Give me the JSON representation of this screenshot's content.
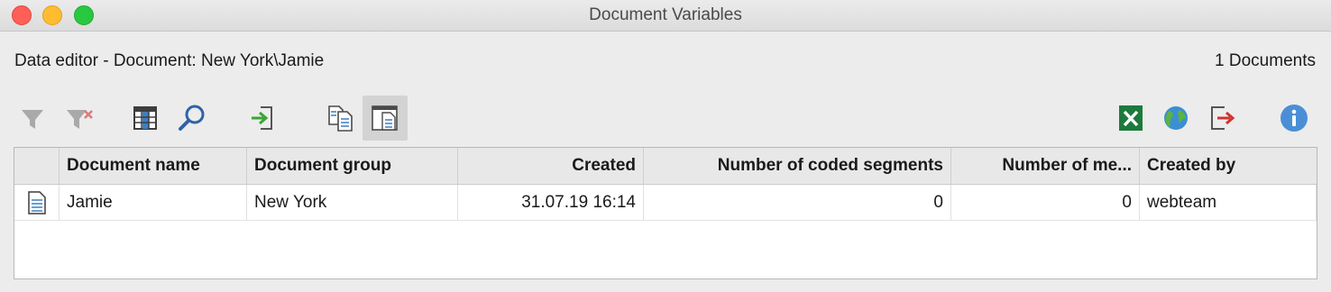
{
  "window": {
    "title": "Document Variables"
  },
  "header": {
    "context": "Data editor - Document: New York\\Jamie",
    "count": "1 Documents"
  },
  "toolbar": {
    "left": [
      {
        "icon": "filter-icon",
        "enabled": false
      },
      {
        "icon": "remove-filter-icon",
        "enabled": false
      },
      {
        "icon": "columns-icon",
        "enabled": true
      },
      {
        "icon": "search-icon",
        "enabled": true
      },
      {
        "icon": "import-icon",
        "enabled": true
      },
      {
        "icon": "document-list-icon",
        "enabled": true
      },
      {
        "icon": "document-window-icon",
        "enabled": true,
        "active": true
      }
    ],
    "right": [
      {
        "icon": "excel-export-icon",
        "color": "#1d7a3c"
      },
      {
        "icon": "globe-icon",
        "color": "#3b8fd3"
      },
      {
        "icon": "export-icon",
        "color": "#d0342c"
      },
      {
        "icon": "info-icon",
        "color": "#4a8fd6"
      }
    ]
  },
  "table": {
    "columns": [
      "Document name",
      "Document group",
      "Created",
      "Number of coded segments",
      "Number of me...",
      "Created by"
    ],
    "rows": [
      {
        "icon": "document-icon",
        "cells": [
          "Jamie",
          "New York",
          "31.07.19 16:14",
          "0",
          "0",
          "webteam"
        ]
      }
    ]
  }
}
